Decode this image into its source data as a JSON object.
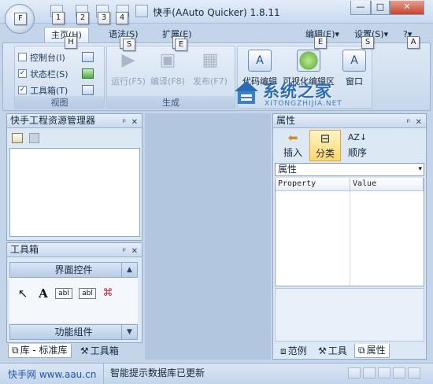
{
  "window": {
    "title": "快手(AAuto Quicker) 1.8.11",
    "minimize": "—",
    "maximize": "□",
    "close": "✕"
  },
  "app_button": {
    "keytip": "F"
  },
  "quick_access": {
    "keytips": [
      "1",
      "2",
      "3",
      "4"
    ],
    "dropdown": "▾"
  },
  "tabs": [
    {
      "label": "主页(H)",
      "keytip": "H"
    },
    {
      "label": "语法(S)",
      "keytip": "S"
    },
    {
      "label": "扩展(E)",
      "keytip": "E"
    },
    {
      "label": "编辑(E)",
      "keytip": "E"
    },
    {
      "label": "设置(S)",
      "keytip": "S"
    }
  ],
  "tabs_right": {
    "arrow1": "▾",
    "arrow2": "▾",
    "help_icon": "?",
    "help_arrow": "▾",
    "help_keytip": "A"
  },
  "ribbon": {
    "view_group": {
      "caption": "视图",
      "items": [
        {
          "label": "控制台(I)",
          "checked": false,
          "mark": ""
        },
        {
          "label": "状态栏(S)",
          "checked": true,
          "mark": "✓"
        },
        {
          "label": "工具箱(T)",
          "checked": true,
          "mark": "✓"
        }
      ]
    },
    "build_group": {
      "caption": "生成",
      "buttons": [
        "运行(F5)",
        "编译(F8)",
        "发布(F7)"
      ]
    },
    "edit_group": {
      "buttons": [
        "代码编辑",
        "可视化编辑区",
        "窗口"
      ]
    }
  },
  "watermark": {
    "main": "系统之家",
    "sub": "XITONGZHIJIA.NET"
  },
  "left_panel": {
    "title": "快手工程资源管理器",
    "pin": "ᵖ",
    "close": "✕"
  },
  "toolbox": {
    "title": "工具箱",
    "pin": "ᵖ",
    "close": "✕",
    "section_ui": "界面控件",
    "section_ui_arrow": "▲",
    "section_func": "功能组件",
    "section_func_arrow": "▼",
    "tools": [
      "↖",
      "A",
      "abl",
      "abl",
      "⌘"
    ]
  },
  "left_bottom_tabs": [
    "库 - 标准库",
    "工具箱"
  ],
  "properties": {
    "title": "属性",
    "pin": "ᵖ",
    "close": "✕",
    "buttons": [
      {
        "label": "插入",
        "icon": "⬅"
      },
      {
        "label": "分类",
        "icon": "⊟"
      },
      {
        "label": "顺序",
        "icon": "AZ↓"
      }
    ],
    "combo_value": "属性",
    "combo_arrow": "▾",
    "columns": [
      "Property",
      "Value"
    ]
  },
  "right_bottom_tabs": [
    "范例",
    "工具",
    "属性"
  ],
  "status": {
    "link": "快手网 www.aau.cn",
    "message": "智能提示数据库已更新"
  }
}
